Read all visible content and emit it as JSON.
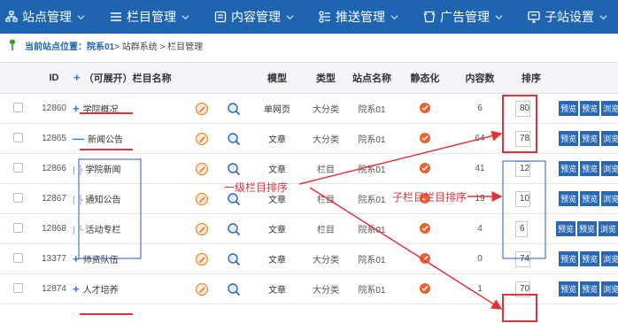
{
  "nav": {
    "items": [
      {
        "label": "站点管理",
        "icon": "sitemap-icon"
      },
      {
        "label": "栏目管理",
        "icon": "list-icon"
      },
      {
        "label": "内容管理",
        "icon": "document-icon"
      },
      {
        "label": "推送管理",
        "icon": "push-icon"
      },
      {
        "label": "广告管理",
        "icon": "ad-icon"
      },
      {
        "label": "子站设置",
        "icon": "monitor-icon"
      }
    ]
  },
  "breadcrumb": {
    "label": "当前站点位置：院系01",
    "path": " > 站群系统 > 栏目管理"
  },
  "table": {
    "headers": {
      "id": "ID",
      "expand": "+",
      "name": "（可展开）栏目名称",
      "model": "模型",
      "type": "类型",
      "site": "站点名称",
      "static": "静态化",
      "count": "内容数",
      "sort": "排序"
    },
    "rows": [
      {
        "id": "12860",
        "prefix": "+",
        "tree": "",
        "name": "学院概况",
        "model": "单网页",
        "type": "大分类",
        "site": "院系01",
        "count": "6",
        "sort": "80"
      },
      {
        "id": "12865",
        "prefix": "—",
        "tree": "",
        "name": "新闻公告",
        "model": "文章",
        "type": "大分类",
        "site": "院系01",
        "count": "64",
        "sort": "78"
      },
      {
        "id": "12866",
        "prefix": "",
        "tree": "| ├",
        "name": "学院新闻",
        "model": "文章",
        "type": "栏目",
        "site": "院系01",
        "count": "41",
        "sort": "12"
      },
      {
        "id": "12867",
        "prefix": "",
        "tree": "| ├",
        "name": "通知公告",
        "model": "文章",
        "type": "栏目",
        "site": "院系01",
        "count": "19",
        "sort": "10"
      },
      {
        "id": "12868",
        "prefix": "",
        "tree": "| └",
        "name": "活动专栏",
        "model": "文章",
        "type": "栏目",
        "site": "院系01",
        "count": "4",
        "sort": "6"
      },
      {
        "id": "13377",
        "prefix": "+",
        "tree": "",
        "name": "师资队伍",
        "model": "文章",
        "type": "大分类",
        "site": "院系01",
        "count": "0",
        "sort": "74"
      },
      {
        "id": "12874",
        "prefix": "+",
        "tree": "",
        "name": "人才培养",
        "model": "文章",
        "type": "大分类",
        "site": "院系01",
        "count": "1",
        "sort": "70"
      }
    ],
    "action_buttons": [
      "预览",
      "预览",
      "浏览"
    ]
  },
  "annotations": {
    "level1": "一级栏目排序",
    "sub": "子栏目栏目排序"
  },
  "colors": {
    "nav_bg": "#1e64b0",
    "annotation_red": "#e5323a",
    "annotation_blue": "#2f58c8",
    "status_orange": "#e8632d"
  }
}
